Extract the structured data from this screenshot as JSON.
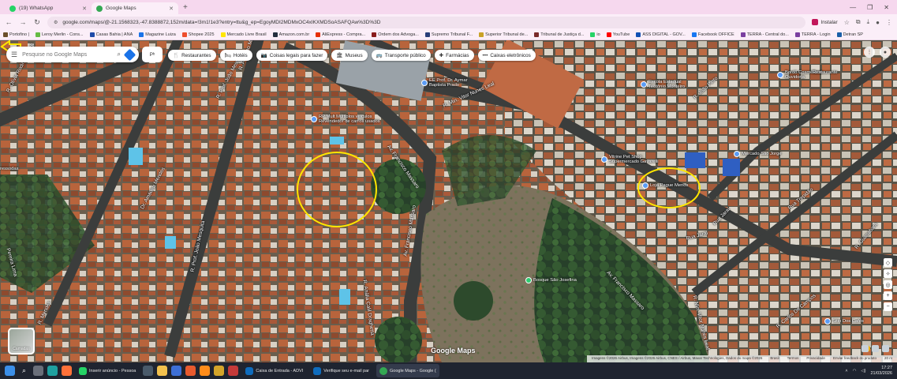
{
  "tabs": [
    {
      "title": "(19) WhatsApp",
      "favicon_color": "#25d366",
      "active": false
    },
    {
      "title": "Google Maps",
      "favicon_color": "#34a853",
      "active": true
    }
  ],
  "address_bar": {
    "url": "google.com/maps/@-21.1568323,-47.8388872,152m/data=!3m1!1e3?entry=ttu&g_ep=EgoyMDI2MDMxOC4xIKXMDSoASAFQAw%3D%3D",
    "install_label": "Instalar"
  },
  "bookmarks": [
    {
      "label": "Portofino |",
      "color": "#6b4f2a"
    },
    {
      "label": "Leroy Merlin - Cons...",
      "color": "#66bb44"
    },
    {
      "label": "Casas Bahia | ANA",
      "color": "#1e4aa8"
    },
    {
      "label": "Magazine Luiza",
      "color": "#1a73e8"
    },
    {
      "label": "Shopee 2025",
      "color": "#ee4d2d"
    },
    {
      "label": "Mercado Livre Brasil",
      "color": "#ffe600"
    },
    {
      "label": "Amazon.com.br",
      "color": "#232f3e"
    },
    {
      "label": "AliExpress - Compra...",
      "color": "#e62e04"
    },
    {
      "label": "Ordem dos Advoga...",
      "color": "#8a1c1c"
    },
    {
      "label": "Supremo Tribunal F...",
      "color": "#2a3f7a"
    },
    {
      "label": "Superior Tribunal de...",
      "color": "#c9a227"
    },
    {
      "label": "Tribunal de Justiça d...",
      "color": "#7a2a2a"
    },
    {
      "label": "io",
      "color": "#25d366"
    },
    {
      "label": "YouTube",
      "color": "#ff0000"
    },
    {
      "label": "ASS DIGITAL - GOV...",
      "color": "#1351b4"
    },
    {
      "label": "Facebook OFFICE",
      "color": "#1877f2"
    },
    {
      "label": "TERRA - Central do...",
      "color": "#7b3fa0"
    },
    {
      "label": "TERRA - Login",
      "color": "#7b3fa0"
    },
    {
      "label": "Detran SP",
      "color": "#1a5fa8"
    }
  ],
  "search": {
    "placeholder": "Pesquise no Google Maps",
    "profile_chip": "Pᵇ"
  },
  "chips": [
    {
      "label": "Restaurantes",
      "icon": "fork-knife-icon",
      "glyph": "🍴"
    },
    {
      "label": "Hotéis",
      "icon": "bed-icon",
      "glyph": "🛏"
    },
    {
      "label": "Coisas legais para fazer",
      "icon": "camera-icon",
      "glyph": "📷"
    },
    {
      "label": "Museus",
      "icon": "museum-icon",
      "glyph": "🏛"
    },
    {
      "label": "Transporte público",
      "icon": "bus-icon",
      "glyph": "🚌"
    },
    {
      "label": "Farmácias",
      "icon": "pharmacy-icon",
      "glyph": "✚"
    },
    {
      "label": "Caixas eletrônicos",
      "icon": "atm-icon",
      "glyph": "•••"
    }
  ],
  "streets": [
    {
      "name": "R. Olívia Rodini Lunardi"
    },
    {
      "name": "R. Prof. João Mesquita"
    },
    {
      "name": "R. Amadeo Mendes"
    },
    {
      "name": "Dr. Amadeu Mendes"
    },
    {
      "name": "Av. Francisco Massaro"
    },
    {
      "name": "R. Min. Vitor Nunes Leal"
    },
    {
      "name": "R. Anália Calil Draghetta"
    },
    {
      "name": "Av. Francisco Massaro"
    },
    {
      "name": "R. Prof. João Mesquita"
    },
    {
      "name": "Av. Francisco Massaro"
    },
    {
      "name": "R. Min. Vitor Nunes Leal"
    },
    {
      "name": "Rua Jaraí"
    },
    {
      "name": "R. Carlos De Campos"
    },
    {
      "name": "R. Mendes"
    },
    {
      "name": "Pereira Lima"
    },
    {
      "name": "Rua Trepidão"
    },
    {
      "name": "R. João Pinto"
    },
    {
      "name": "R. Guanabara"
    },
    {
      "name": "Rua Jaraí"
    }
  ],
  "pois": [
    {
      "line1": "EE Prof. Dr. Aymar",
      "line2": "Baptista Prado",
      "color": "#5b9cf5",
      "icon": "school-icon"
    },
    {
      "line1": "RP Mult Multiplos veiculos",
      "line2": "Revendedor de carros usados",
      "color": "#5b9cf5",
      "icon": "car-dealer-icon"
    },
    {
      "line1": "Escola Estadual",
      "line2": "Teotônio Monteiro",
      "color": "#5b9cf5",
      "icon": "school-icon"
    },
    {
      "line1": "Vitrine Pet Shop",
      "line2": "Supermercado Gavarelli",
      "color": "#5b9cf5",
      "icon": "store-icon"
    },
    {
      "line1": "Loja Pague Menos",
      "line2": "",
      "color": "#5b9cf5",
      "icon": "store-icon"
    },
    {
      "line1": "Mercado São Jorge",
      "line2": "",
      "color": "#5b9cf5",
      "icon": "store-icon"
    },
    {
      "line1": "Bosque São Josefina",
      "line2": "",
      "color": "#2ecc71",
      "icon": "park-icon"
    },
    {
      "line1": "Bordô Cosméticos",
      "line2": "Ouvidoria",
      "color": "#5b9cf5",
      "icon": "store-icon"
    },
    {
      "line1": "ressodas",
      "line2": "",
      "color": "#5b9cf5",
      "icon": "store-icon"
    },
    {
      "line1": "Sitio Dos Cafés",
      "line2": "",
      "color": "#5b9cf5",
      "icon": "store-icon"
    },
    {
      "line1": "Restaurante",
      "line2": "",
      "color": "#5b9cf5",
      "icon": "restaurant-icon"
    }
  ],
  "map": {
    "layers_label": "Camadas",
    "logo": "Google Maps",
    "attribution": [
      "Imagens ©2026 Airbus, Imagens ©2026 Airbus, CNES / Airbus, Maxar Technologies, Dados do mapa ©2026",
      "Brasil",
      "Termos",
      "Privacidade",
      "Enviar feedback do produto",
      "20 m"
    ]
  },
  "taskbar": {
    "apps": [
      {
        "label": "Inserir anúncio - Pessoa",
        "color": "#25d366"
      },
      {
        "label": "Caixa de Entrada - ADVI",
        "color": "#0f6cbd"
      },
      {
        "label": "Verifique seu e-mail par",
        "color": "#0f6cbd"
      },
      {
        "label": "Google Maps - Google (",
        "color": "#34a853"
      }
    ],
    "time": "17:27",
    "date": "21/03/2026"
  },
  "colors": {
    "highlight": "#ffe600",
    "chrome_tab": "#f6d8ee",
    "accent": "#1a73e8"
  }
}
